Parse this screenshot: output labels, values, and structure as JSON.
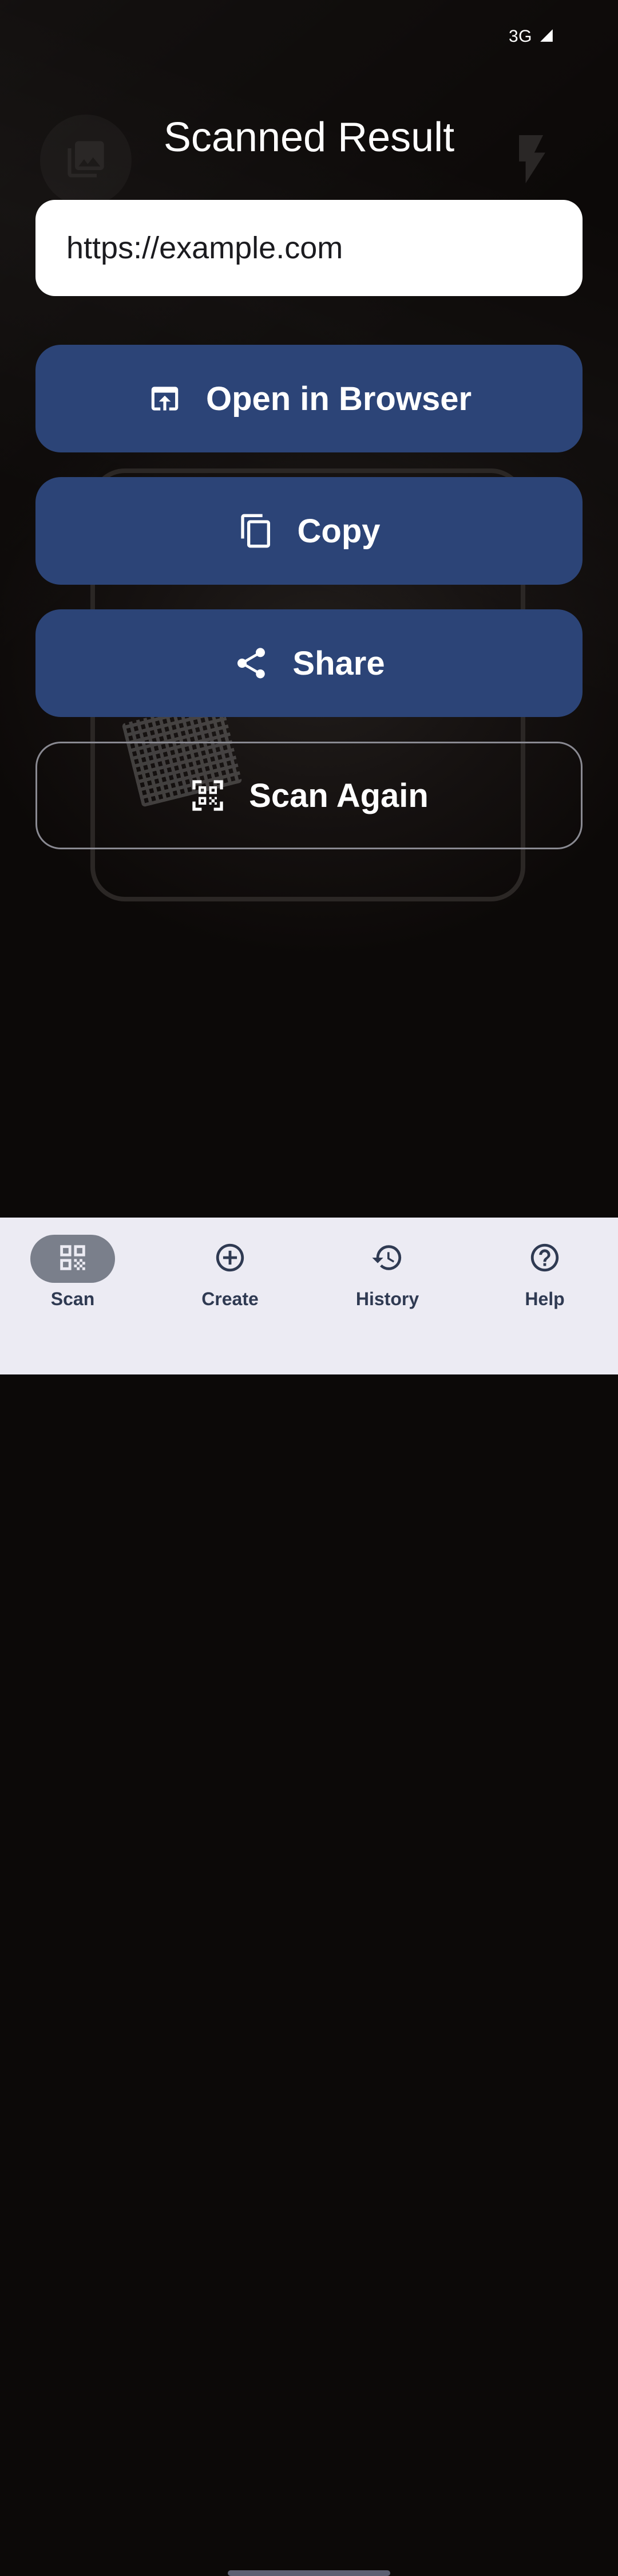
{
  "status_bar": {
    "network": "3G",
    "signal_icon": "signal-icon"
  },
  "camera": {
    "gallery_icon": "gallery-icon",
    "flash_icon": "flash-icon"
  },
  "result": {
    "title": "Scanned Result",
    "content": "https://example.com"
  },
  "actions": {
    "open_label": "Open in Browser",
    "open_icon": "open-in-browser-icon",
    "copy_label": "Copy",
    "copy_icon": "copy-icon",
    "share_label": "Share",
    "share_icon": "share-icon",
    "scan_again_label": "Scan Again",
    "scan_again_icon": "qr-scan-icon"
  },
  "bottom_nav": {
    "items": [
      {
        "label": "Scan",
        "icon": "qr-code-icon",
        "active": true
      },
      {
        "label": "Create",
        "icon": "add-circle-icon",
        "active": false
      },
      {
        "label": "History",
        "icon": "history-icon",
        "active": false
      },
      {
        "label": "Help",
        "icon": "help-icon",
        "active": false
      }
    ]
  },
  "colors": {
    "primary_button": "#2c4477",
    "background": "#0c0908",
    "nav_background": "#ecebf3",
    "nav_active_pill": "#7a7f8b",
    "nav_text": "#2f3a52"
  }
}
